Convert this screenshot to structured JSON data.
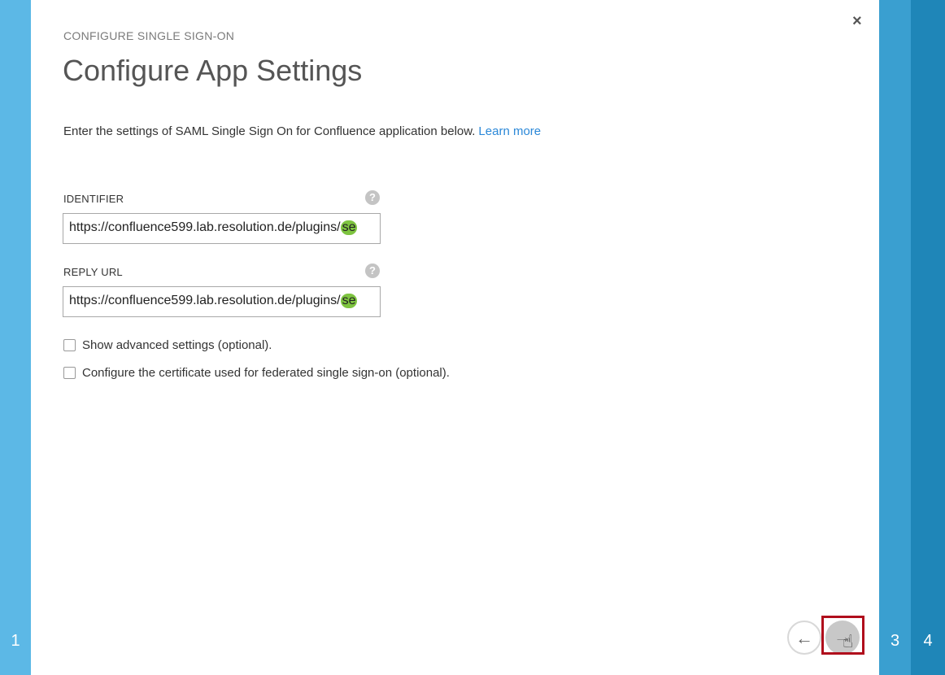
{
  "wizard": {
    "steps": {
      "left": "1",
      "right_a": "3",
      "right_b": "4"
    },
    "label": "CONFIGURE SINGLE SIGN-ON",
    "title": "Configure App Settings",
    "intro_text": "Enter the settings of SAML Single Sign On for Confluence application below.",
    "learn_more": "Learn more",
    "close_glyph": "×"
  },
  "fields": {
    "identifier": {
      "label": "IDENTIFIER",
      "value_main": "https://confluence599.lab.resolution.de/plugins/",
      "value_tail": "se",
      "help_glyph": "?"
    },
    "reply_url": {
      "label": "REPLY URL",
      "value_main": "https://confluence599.lab.resolution.de/plugins/",
      "value_tail": "se",
      "help_glyph": "?"
    }
  },
  "options": {
    "advanced": {
      "label": "Show advanced settings (optional).",
      "checked": false
    },
    "certificate": {
      "label": "Configure the certificate used for federated single sign-on (optional).",
      "checked": false
    }
  },
  "nav": {
    "back_glyph": "←",
    "next_glyph": "→",
    "cursor_glyph": "☝"
  },
  "icons": {
    "close": "close-icon",
    "help": "question-circle-icon",
    "back": "arrow-left-icon",
    "next": "arrow-right-icon",
    "cursor": "hand-pointer-icon"
  },
  "colors": {
    "left_rail": "#5cb8e6",
    "rail_3": "#3a9fd0",
    "rail_4": "#1f86b8",
    "link": "#2b88d8",
    "highlight": "#b00d1c",
    "autocomplete_marker": "#7ec440"
  }
}
